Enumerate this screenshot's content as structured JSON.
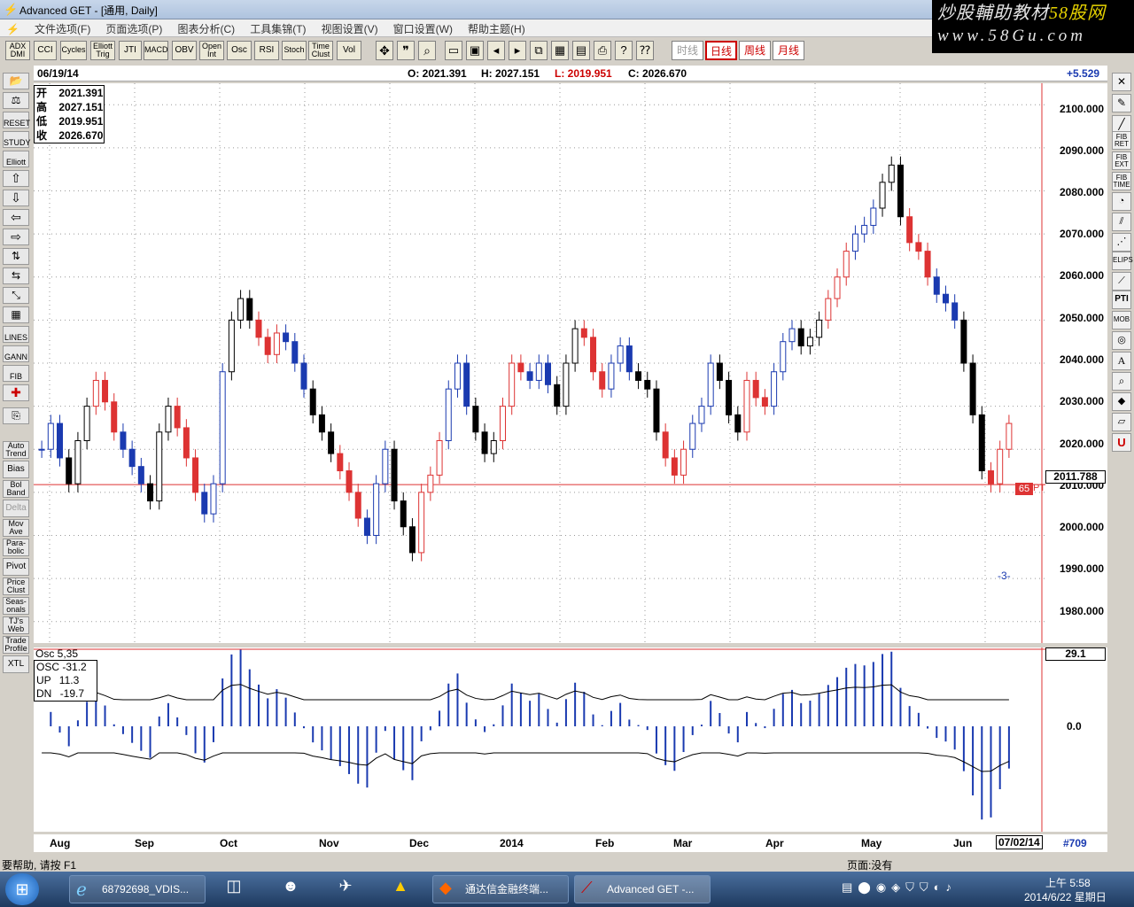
{
  "window": {
    "title": "Advanced GET - [通用, Daily]"
  },
  "watermark": {
    "line1_a": "炒股輔助教材",
    "line1_b": "58股网",
    "line2": "www.58Gu.com"
  },
  "menu": [
    "文件选项(F)",
    "页面选项(P)",
    "图表分析(C)",
    "工具集锦(T)",
    "视图设置(V)",
    "窗口设置(W)",
    "帮助主题(H)"
  ],
  "toolbar": {
    "studies": [
      "ADX DMI",
      "CCI",
      "Cycles",
      "Elliott Trig",
      "JTI",
      "MACD",
      "OBV",
      "Open Int",
      "Osc",
      "RSI",
      "Stoch",
      "Time Clust",
      "Vol"
    ],
    "periods": [
      "时线",
      "日线",
      "周线",
      "月线"
    ]
  },
  "info": {
    "date": "06/19/14",
    "o": "O: 2021.391",
    "h": "H: 2027.151",
    "l": "L: 2019.951",
    "c": "C: 2026.670",
    "chg": "+5.529"
  },
  "ohlc_box": [
    {
      "k": "开",
      "v": "2021.391"
    },
    {
      "k": "高",
      "v": "2027.151"
    },
    {
      "k": "低",
      "v": "2019.951"
    },
    {
      "k": "收",
      "v": "2026.670"
    }
  ],
  "left_tools": [
    "RESET",
    "STUDY",
    "Elliott",
    "LINES",
    "GANN",
    "FIB",
    "Auto Trend",
    "Bias",
    "Bol Band",
    "Delta",
    "Mov Ave",
    "Para-bolic",
    "Pivot",
    "Price Clust",
    "Seas-onals",
    "TJ's Web",
    "Trade Profile",
    "XTL"
  ],
  "right_tools": [
    "FIB RET",
    "FIB EXT",
    "FIB TIME",
    "ELIPS",
    "PTI",
    "MOB"
  ],
  "price_axis": [
    "2100.000",
    "2090.000",
    "2080.000",
    "2070.000",
    "2060.000",
    "2050.000",
    "2040.000",
    "2030.000",
    "2020.000",
    "2010.000",
    "2000.000",
    "1990.000",
    "1980.000"
  ],
  "current_price": "2011.788",
  "pti": "65",
  "pti_label": "PTI",
  "osc": {
    "header": "Osc 5,35",
    "value": "29.1",
    "zero": "0.0",
    "box": [
      {
        "k": "OSC",
        "v": "-31.2"
      },
      {
        "k": "UP",
        "v": "11.3"
      },
      {
        "k": "DN",
        "v": "-19.7"
      }
    ]
  },
  "x_axis": [
    "Aug",
    "Sep",
    "Oct",
    "Nov",
    "Dec",
    "2014",
    "Feb",
    "Mar",
    "Apr",
    "May",
    "Jun",
    "07/02/14",
    "#709"
  ],
  "status": {
    "help": "要帮助, 请按 F1",
    "page": "页面:没有"
  },
  "taskbar": {
    "items": [
      "68792698_VDIS...",
      "通达信金融终端...",
      "Advanced GET -..."
    ],
    "time": "上午 5:58",
    "date": "2014/6/22 星期日"
  },
  "wave_label_minus3": "-3-",
  "chart_data": {
    "type": "candlestick",
    "ylim": [
      1975,
      2105
    ],
    "current_price": 2011.788,
    "last_bar": {
      "date": "06/19/14",
      "open": 2021.391,
      "high": 2027.151,
      "low": 2019.951,
      "close": 2026.67
    },
    "closes": [
      2020,
      2026,
      2018,
      2012,
      2022,
      2030,
      2036,
      2031,
      2024,
      2020,
      2016,
      2012,
      2008,
      2024,
      2030,
      2025,
      2018,
      2010,
      2005,
      2012,
      2038,
      2050,
      2055,
      2050,
      2046,
      2042,
      2047,
      2045,
      2040,
      2034,
      2028,
      2024,
      2019,
      2015,
      2010,
      2004,
      2000,
      2012,
      2020,
      2008,
      2002,
      1996,
      2010,
      2014,
      2022,
      2034,
      2040,
      2030,
      2024,
      2019,
      2022,
      2030,
      2040,
      2038,
      2036,
      2040,
      2035,
      2030,
      2040,
      2048,
      2046,
      2038,
      2034,
      2040,
      2044,
      2038,
      2036,
      2034,
      2024,
      2018,
      2014,
      2020,
      2026,
      2030,
      2040,
      2036,
      2028,
      2024,
      2036,
      2032,
      2030,
      2038,
      2045,
      2048,
      2044,
      2046,
      2050,
      2055,
      2060,
      2066,
      2070,
      2072,
      2076,
      2082,
      2086,
      2074,
      2068,
      2066,
      2060,
      2056,
      2054,
      2050,
      2040,
      2028,
      2015,
      2012,
      2020,
      2026
    ]
  }
}
